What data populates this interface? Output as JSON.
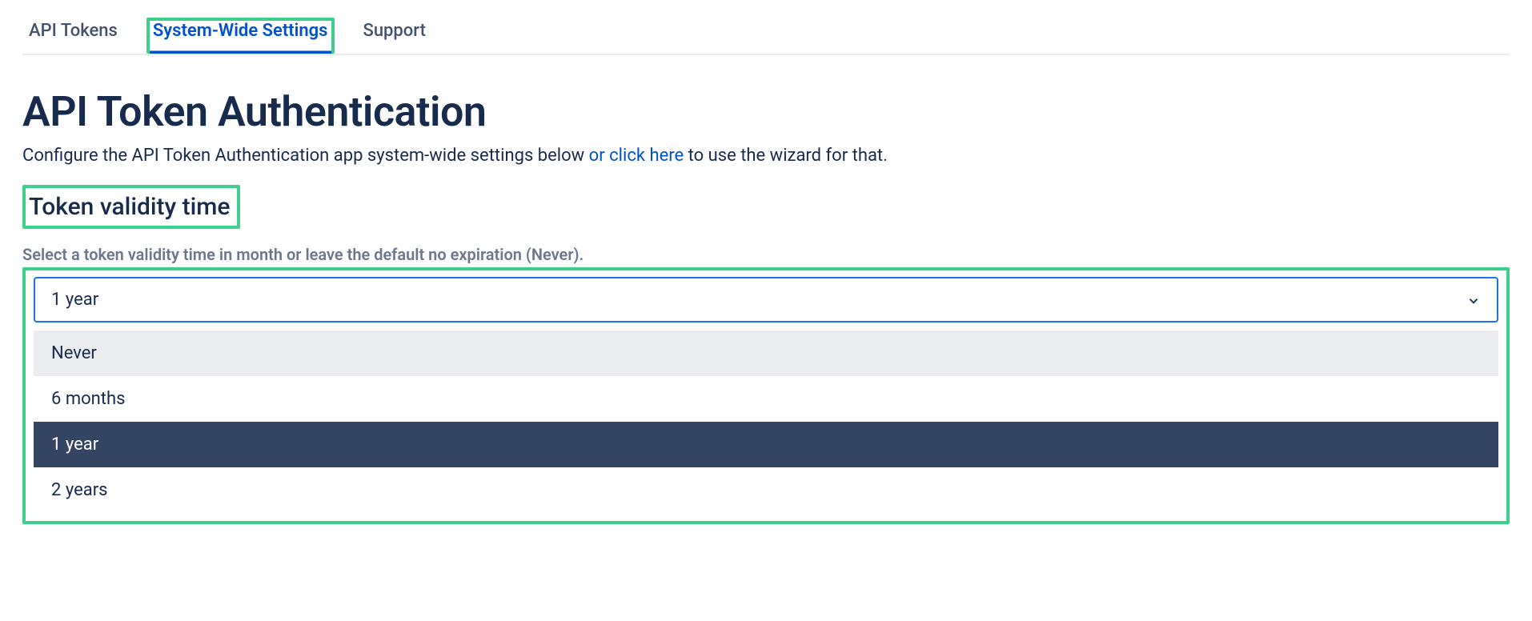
{
  "tabs": [
    {
      "label": "API Tokens",
      "active": false
    },
    {
      "label": "System-Wide Settings",
      "active": true
    },
    {
      "label": "Support",
      "active": false
    }
  ],
  "page": {
    "title": "API Token Authentication",
    "subtitle_prefix": "Configure the API Token Authentication app system-wide settings below ",
    "subtitle_link": "or click here",
    "subtitle_suffix": " to use the wizard for that."
  },
  "section": {
    "heading": "Token validity time",
    "helper": "Select a token validity time in month or leave the default no expiration (Never)."
  },
  "select": {
    "value": "1 year",
    "options": [
      {
        "label": "Never",
        "state": "hover"
      },
      {
        "label": "6 months",
        "state": "normal"
      },
      {
        "label": "1 year",
        "state": "selected"
      },
      {
        "label": "2 years",
        "state": "normal"
      }
    ]
  }
}
